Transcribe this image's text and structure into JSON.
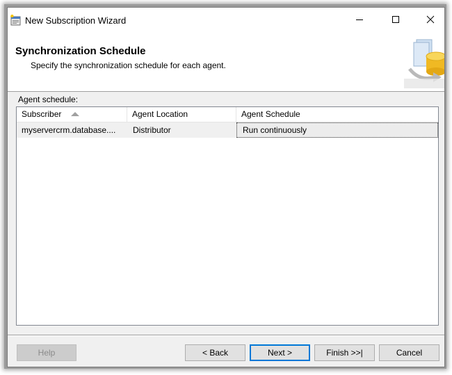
{
  "window": {
    "title": "New Subscription Wizard",
    "icon": "wizard-app-icon",
    "controls": [
      "minimize-icon",
      "maximize-icon",
      "close-icon"
    ]
  },
  "header": {
    "title": "Synchronization Schedule",
    "subtitle": "Specify the synchronization schedule for each agent.",
    "graphic": "database-sync-graphic"
  },
  "section_label": "Agent schedule:",
  "grid": {
    "columns": [
      "Subscriber",
      "Agent Location",
      "Agent Schedule"
    ],
    "sort": {
      "column": "Subscriber",
      "direction": "ascending"
    },
    "rows": [
      {
        "subscriber": "myservercrm.database....",
        "agent_location": "Distributor",
        "agent_schedule": "Run continuously"
      }
    ]
  },
  "buttons": {
    "help": "Help",
    "back": "< Back",
    "next": "Next >",
    "finish": "Finish >>|",
    "cancel": "Cancel"
  },
  "colors": {
    "accent": "#0078d7",
    "dialog_bg": "#f0f0f0",
    "selected_row": "#f0f0f0"
  }
}
